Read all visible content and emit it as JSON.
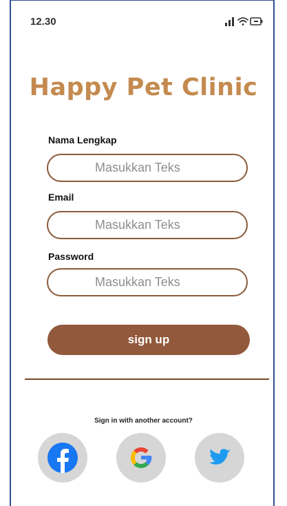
{
  "status_bar": {
    "time": "12.30",
    "icons": [
      "signal-icon",
      "wifi-icon",
      "battery-icon"
    ]
  },
  "app": {
    "title": "Happy Pet Clinic"
  },
  "form": {
    "name_label": "Nama Lengkap",
    "name_placeholder": "Masukkan Teks",
    "email_label": "Email",
    "email_placeholder": "Masukkan Teks",
    "password_label": "Password",
    "password_placeholder": "Masukkan Teks",
    "signup_label": "sign up"
  },
  "alt_signin": {
    "prompt": "Sign in with another account?",
    "providers": [
      "facebook-icon",
      "google-icon",
      "twitter-icon"
    ]
  },
  "colors": {
    "title": "#c48a4f",
    "button": "#92593c",
    "field_border": "#8a5a3a",
    "social_bg": "#d6d6d6",
    "facebook": "#1877f2",
    "twitter": "#1d9bf0"
  }
}
